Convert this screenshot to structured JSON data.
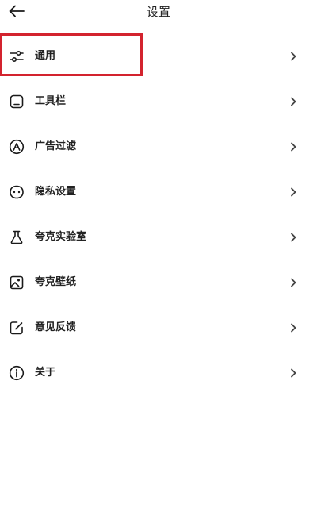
{
  "header": {
    "title": "设置",
    "back_icon": "arrow-left-icon"
  },
  "menu": {
    "items": [
      {
        "label": "通用",
        "icon": "sliders-icon"
      },
      {
        "label": "工具栏",
        "icon": "toolbar-icon"
      },
      {
        "label": "广告过滤",
        "icon": "ad-block-icon"
      },
      {
        "label": "隐私设置",
        "icon": "privacy-mask-icon"
      },
      {
        "label": "夸克实验室",
        "icon": "flask-icon"
      },
      {
        "label": "夸克壁纸",
        "icon": "wallpaper-image-icon"
      },
      {
        "label": "意见反馈",
        "icon": "feedback-edit-icon"
      },
      {
        "label": "关于",
        "icon": "info-icon"
      }
    ]
  },
  "colors": {
    "highlight": "#d3232e",
    "text": "#222222",
    "icon": "#1a1a1a",
    "chevron": "#444444"
  }
}
